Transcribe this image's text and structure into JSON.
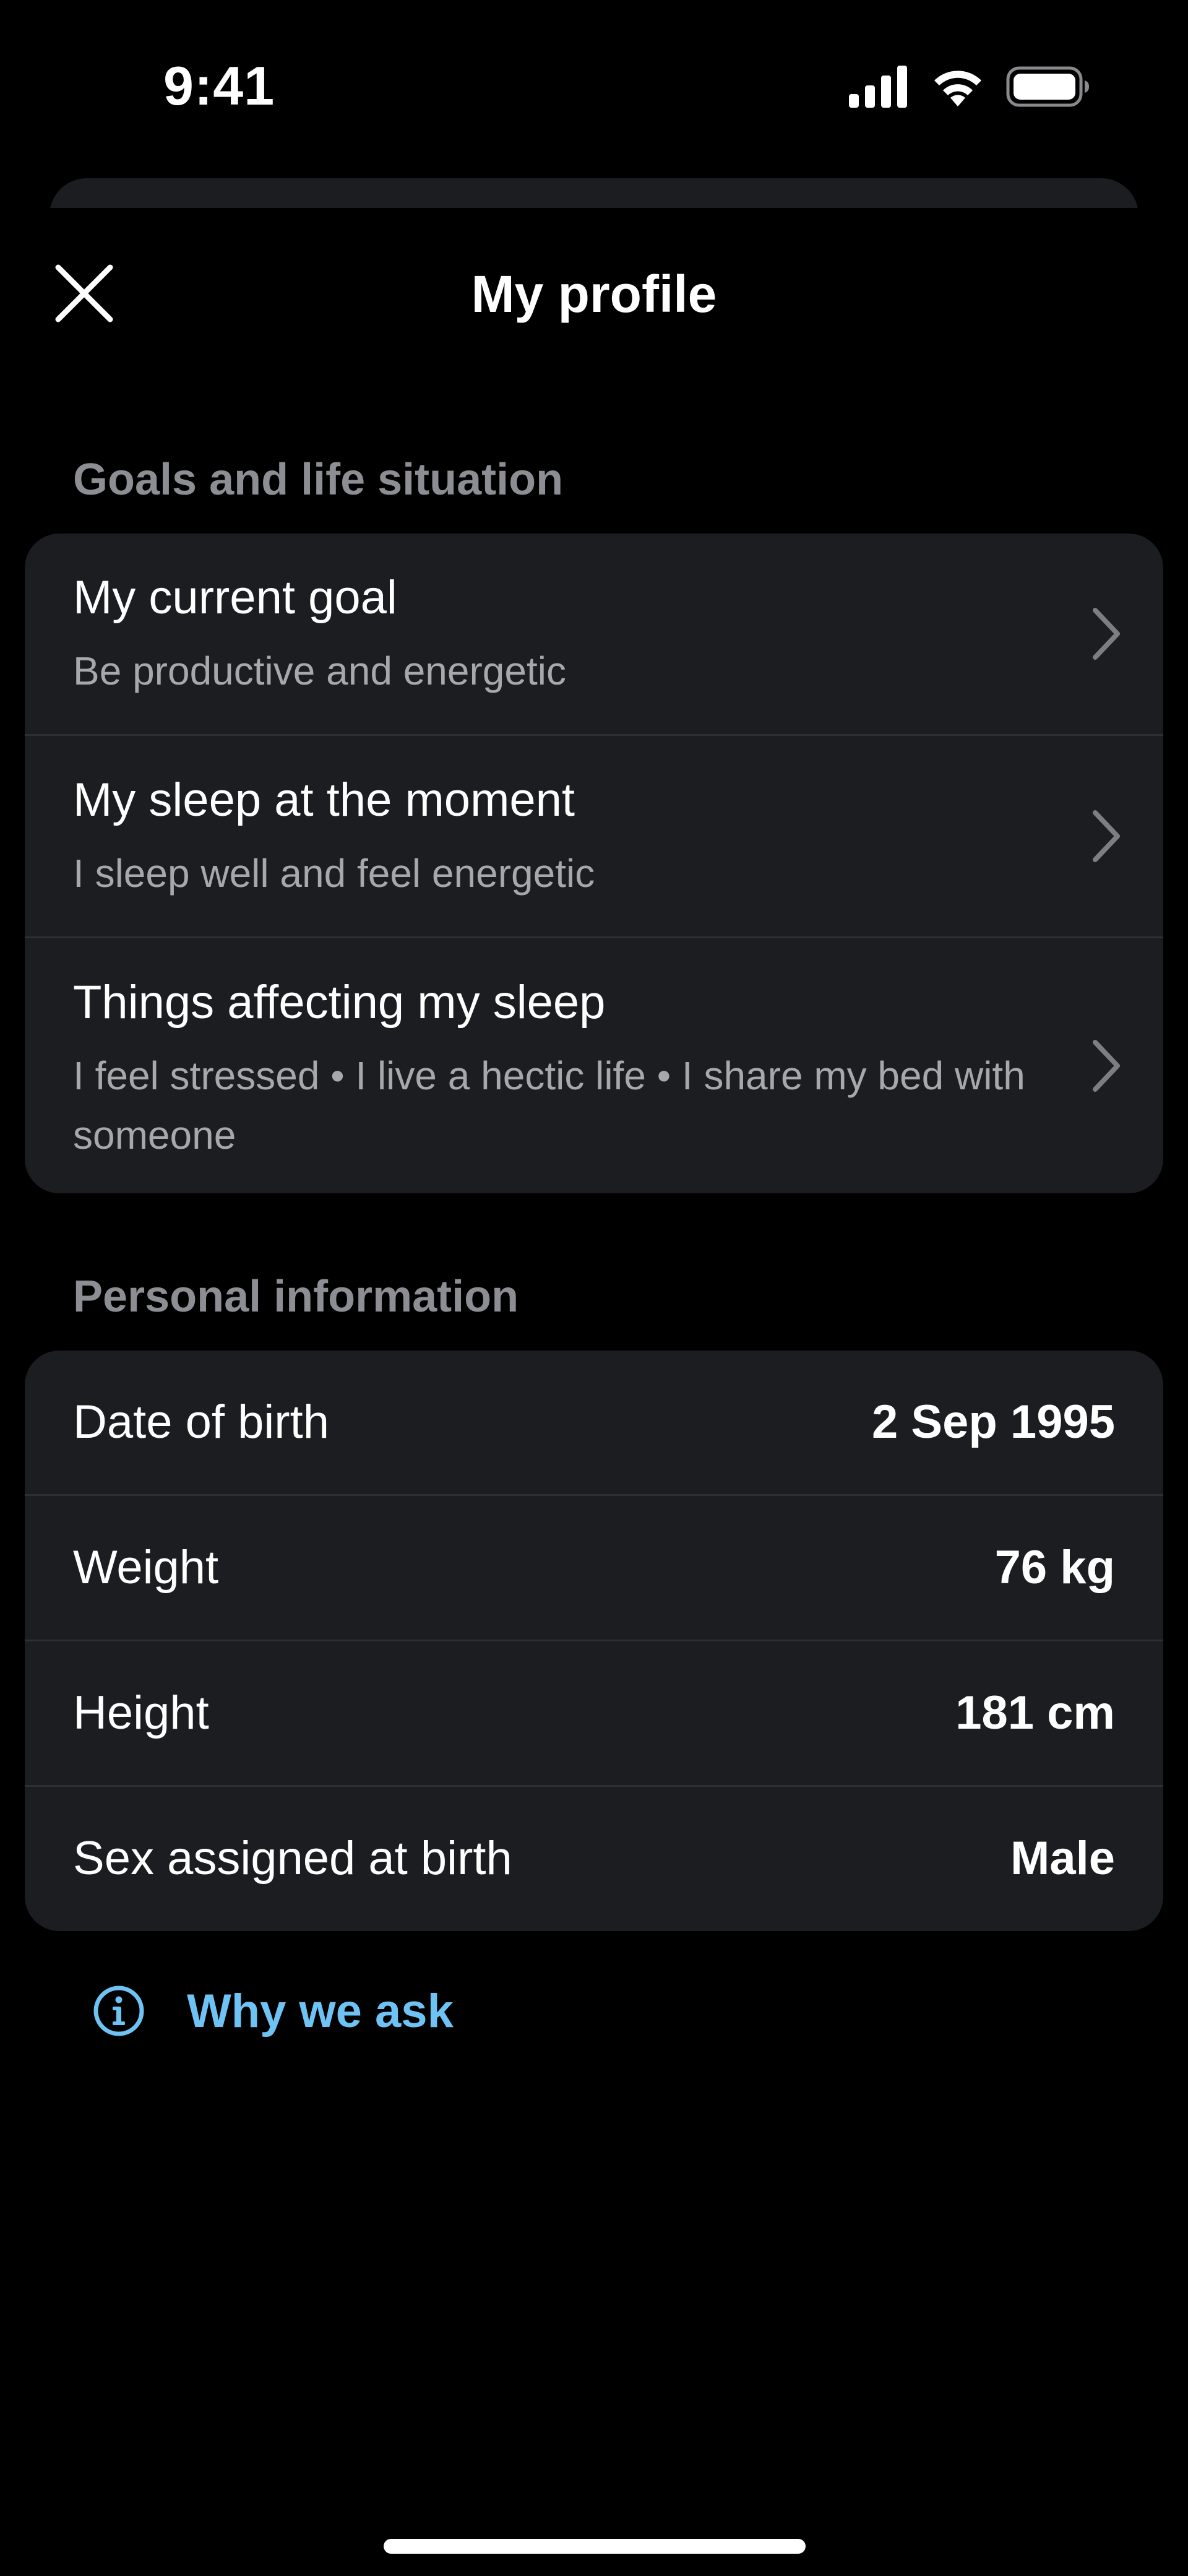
{
  "status_bar": {
    "time": "9:41",
    "icons": [
      "cellular-signal-icon",
      "wifi-icon",
      "battery-icon"
    ]
  },
  "header": {
    "title": "My profile",
    "close_icon": "close-icon"
  },
  "goals_section": {
    "title": "Goals and life situation",
    "items": [
      {
        "title": "My current goal",
        "subtitle": "Be productive and energetic"
      },
      {
        "title": "My sleep at the moment",
        "subtitle": "I sleep well and feel energetic"
      },
      {
        "title": "Things affecting my sleep",
        "subtitle": "I feel stressed • I live a hectic life • I share my bed with someone"
      }
    ]
  },
  "personal_section": {
    "title": "Personal information",
    "rows": [
      {
        "label": "Date of birth",
        "value": "2 Sep 1995"
      },
      {
        "label": "Weight",
        "value": "76 kg"
      },
      {
        "label": "Height",
        "value": "181 cm"
      },
      {
        "label": "Sex assigned at birth",
        "value": "Male"
      }
    ]
  },
  "why_link": {
    "label": "Why we ask",
    "icon": "info-icon"
  },
  "colors": {
    "background": "#000000",
    "card": "#1c1d21",
    "divider": "#2e2f34",
    "section_header": "#8d8e94",
    "subtitle": "#a7a8ad",
    "link": "#6ec3f4"
  }
}
